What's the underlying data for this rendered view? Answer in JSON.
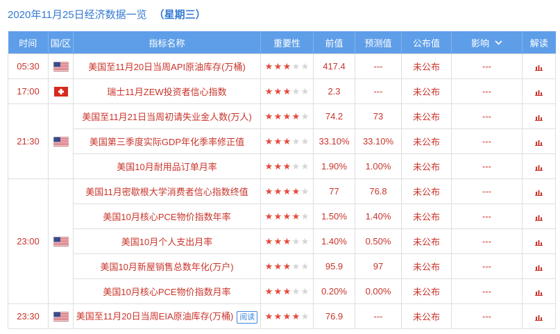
{
  "title": {
    "date": "2020年11月25日经济数据一览",
    "weekday": "（星期三）"
  },
  "colors": {
    "title": "#3479d3",
    "header_bg": "#5e9ee8",
    "text_red": "#c9342b",
    "text_red_dark": "#b8312a",
    "muted": "#555555",
    "star_on": "#e24a3b",
    "star_off": "#d5d5d5",
    "border": "#dedede",
    "badge": "#3f86d8"
  },
  "columns": {
    "time": "时间",
    "region": "国/区",
    "indicator": "指标名称",
    "importance": "重要性",
    "previous": "前值",
    "forecast": "预测值",
    "actual": "公布值",
    "impact": "影响",
    "analysis": "解读"
  },
  "icons": {
    "impact_dropdown": "chevron-down-icon",
    "analysis": "bar-chart-icon",
    "star_filled": "star-filled-icon",
    "star_empty": "star-empty-icon"
  },
  "importance_scale": 5,
  "groups": [
    {
      "time": "05:30",
      "flag": "us-flag-icon",
      "rows": [
        {
          "indicator": "美国至11月20日当周API原油库存(万桶)",
          "importance": 3,
          "previous": "417.4",
          "forecast": "---",
          "actual": "未公布",
          "impact": "---"
        }
      ]
    },
    {
      "time": "17:00",
      "flag": "swiss-flag-icon",
      "rows": [
        {
          "indicator": "瑞士11月ZEW投资者信心指数",
          "importance": 3,
          "previous": "2.3",
          "forecast": "---",
          "actual": "未公布",
          "impact": "---"
        }
      ]
    },
    {
      "time": "21:30",
      "flag": "us-flag-icon",
      "rows": [
        {
          "indicator": "美国至11月21日当周初请失业金人数(万人)",
          "importance": 4,
          "previous": "74.2",
          "forecast": "73",
          "actual": "未公布",
          "impact": "---"
        },
        {
          "indicator": "美国第三季度实际GDP年化季率修正值",
          "importance": 3,
          "previous": "33.10%",
          "forecast": "33.10%",
          "actual": "未公布",
          "impact": "---"
        },
        {
          "indicator": "美国10月耐用品订单月率",
          "importance": 3,
          "previous": "1.90%",
          "forecast": "1.00%",
          "actual": "未公布",
          "impact": "---"
        }
      ]
    },
    {
      "time": "23:00",
      "flag": "us-flag-icon",
      "rows": [
        {
          "indicator": "美国11月密歇根大学消费者信心指数终值",
          "importance": 4,
          "previous": "77",
          "forecast": "76.8",
          "actual": "未公布",
          "impact": "---"
        },
        {
          "indicator": "美国10月核心PCE物价指数年率",
          "importance": 4,
          "previous": "1.50%",
          "forecast": "1.40%",
          "actual": "未公布",
          "impact": "---"
        },
        {
          "indicator": "美国10月个人支出月率",
          "importance": 3,
          "previous": "1.40%",
          "forecast": "0.50%",
          "actual": "未公布",
          "impact": "---"
        },
        {
          "indicator": "美国10月新屋销售总数年化(万户)",
          "importance": 3,
          "previous": "95.9",
          "forecast": "97",
          "actual": "未公布",
          "impact": "---"
        },
        {
          "indicator": "美国10月核心PCE物价指数月率",
          "importance": 3,
          "previous": "0.20%",
          "forecast": "0.00%",
          "actual": "未公布",
          "impact": "---"
        }
      ]
    },
    {
      "time": "23:30",
      "flag": "us-flag-icon",
      "rows": [
        {
          "indicator": "美国至11月20日当周EIA原油库存(万桶)",
          "badge": "阅读",
          "importance": 4,
          "previous": "76.9",
          "forecast": "---",
          "actual": "未公布",
          "impact": "---"
        }
      ]
    }
  ]
}
